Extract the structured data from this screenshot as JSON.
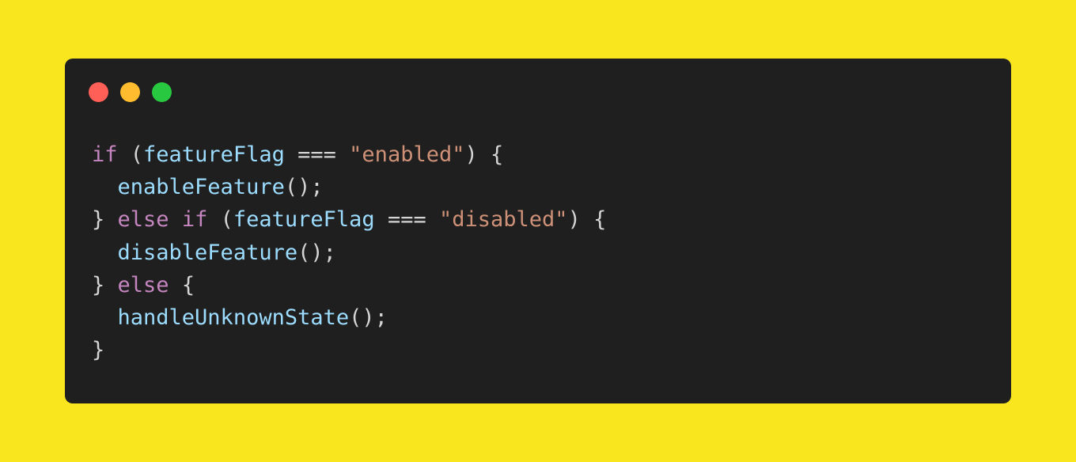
{
  "colors": {
    "background": "#f9e61f",
    "window": "#1f1f1f",
    "close": "#ff5f57",
    "minimize": "#febc2e",
    "maximize": "#28c840",
    "keyword": "#c586c0",
    "identifier": "#9cdcfe",
    "string": "#ce9178",
    "punctuation": "#d4d4d4"
  },
  "window_controls": [
    {
      "name": "close-button",
      "color": "#ff5f57"
    },
    {
      "name": "minimize-button",
      "color": "#febc2e"
    },
    {
      "name": "maximize-button",
      "color": "#28c840"
    }
  ],
  "code": {
    "language": "javascript",
    "lines": [
      [
        {
          "type": "kw",
          "text": "if"
        },
        {
          "type": "plain",
          "text": " "
        },
        {
          "type": "punct",
          "text": "("
        },
        {
          "type": "ident",
          "text": "featureFlag"
        },
        {
          "type": "plain",
          "text": " "
        },
        {
          "type": "op",
          "text": "==="
        },
        {
          "type": "plain",
          "text": " "
        },
        {
          "type": "str",
          "text": "\"enabled\""
        },
        {
          "type": "punct",
          "text": ")"
        },
        {
          "type": "plain",
          "text": " "
        },
        {
          "type": "punct",
          "text": "{"
        }
      ],
      [
        {
          "type": "plain",
          "text": "  "
        },
        {
          "type": "fn",
          "text": "enableFeature"
        },
        {
          "type": "punct",
          "text": "();"
        }
      ],
      [
        {
          "type": "punct",
          "text": "}"
        },
        {
          "type": "plain",
          "text": " "
        },
        {
          "type": "kw",
          "text": "else"
        },
        {
          "type": "plain",
          "text": " "
        },
        {
          "type": "kw",
          "text": "if"
        },
        {
          "type": "plain",
          "text": " "
        },
        {
          "type": "punct",
          "text": "("
        },
        {
          "type": "ident",
          "text": "featureFlag"
        },
        {
          "type": "plain",
          "text": " "
        },
        {
          "type": "op",
          "text": "==="
        },
        {
          "type": "plain",
          "text": " "
        },
        {
          "type": "str",
          "text": "\"disabled\""
        },
        {
          "type": "punct",
          "text": ")"
        },
        {
          "type": "plain",
          "text": " "
        },
        {
          "type": "punct",
          "text": "{"
        }
      ],
      [
        {
          "type": "plain",
          "text": "  "
        },
        {
          "type": "fn",
          "text": "disableFeature"
        },
        {
          "type": "punct",
          "text": "();"
        }
      ],
      [
        {
          "type": "punct",
          "text": "}"
        },
        {
          "type": "plain",
          "text": " "
        },
        {
          "type": "kw",
          "text": "else"
        },
        {
          "type": "plain",
          "text": " "
        },
        {
          "type": "punct",
          "text": "{"
        }
      ],
      [
        {
          "type": "plain",
          "text": "  "
        },
        {
          "type": "fn",
          "text": "handleUnknownState"
        },
        {
          "type": "punct",
          "text": "();"
        }
      ],
      [
        {
          "type": "punct",
          "text": "}"
        }
      ]
    ]
  }
}
